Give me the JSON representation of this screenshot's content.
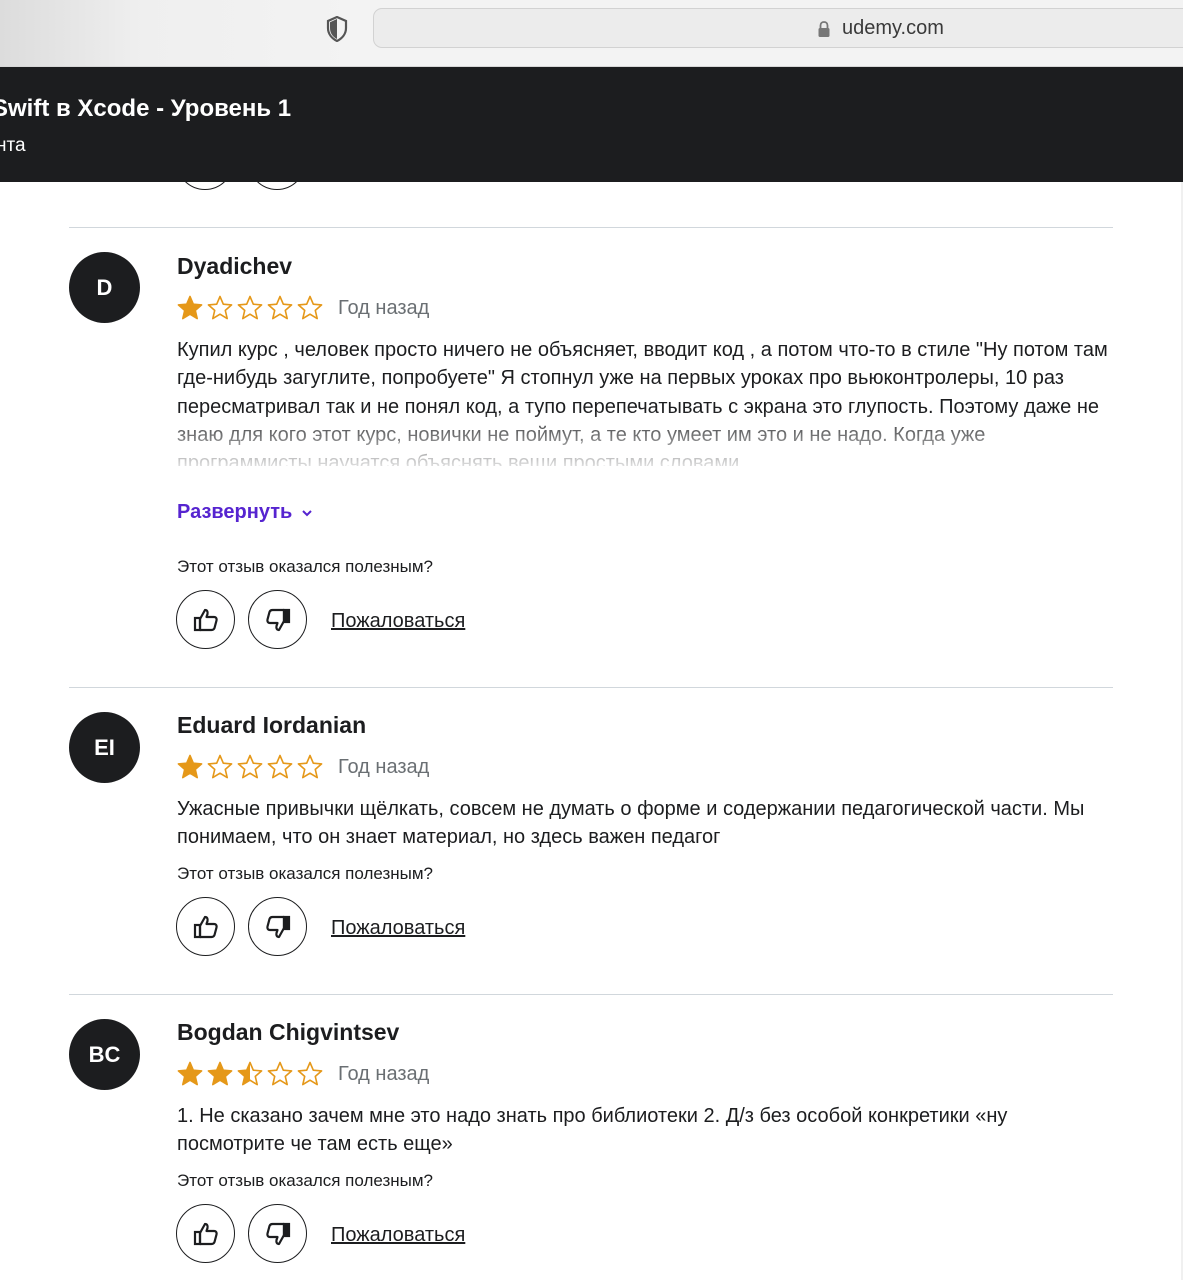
{
  "browser": {
    "url": "udemy.com"
  },
  "course": {
    "title": "Swift в Xcode - Уровень 1",
    "subtitle": "нта"
  },
  "review_ui": {
    "helpful_question": "Этот отзыв оказался полезным?",
    "report_label": "Пожаловаться",
    "expand_label": "Развернуть",
    "star_color": "#e59819",
    "avatar_color": "#1c1d1f",
    "link_color": "#5624d0"
  },
  "reviews": [
    {
      "initials": "D",
      "name": "Dyadichev",
      "rating": 1,
      "date": "Год назад",
      "text": "Купил курс , человек просто ничего не объясняет, вводит код , а потом что-то в стиле \"Ну потом там где-нибудь загуглите, попробуете\" Я стопнул уже на первых уроках про вьюконтролеры, 10 раз пересматривал так и не понял код, а тупо перепечатывать с экрана это глупость. Поэтому даже не знаю для кого этот курс, новички не поймут, а те кто умеет им это и не надо. Когда уже программисты научатся объяснять вещи простыми словами,",
      "truncated": true
    },
    {
      "initials": "EI",
      "name": "Eduard Iordanian",
      "rating": 1,
      "date": "Год назад",
      "text": "Ужасные привычки щёлкать, совсем не думать о форме и содержании педагогической части. Мы понимаем, что он знает материал, но здесь важен педагог",
      "truncated": false
    },
    {
      "initials": "BC",
      "name": "Bogdan Chigvintsev",
      "rating": 2.5,
      "date": "Год назад",
      "text": "1. Не сказано зачем мне это надо знать про библиотеки 2. Д/з без особой конкретики «ну посмотрите че там есть еще»",
      "truncated": false
    }
  ]
}
